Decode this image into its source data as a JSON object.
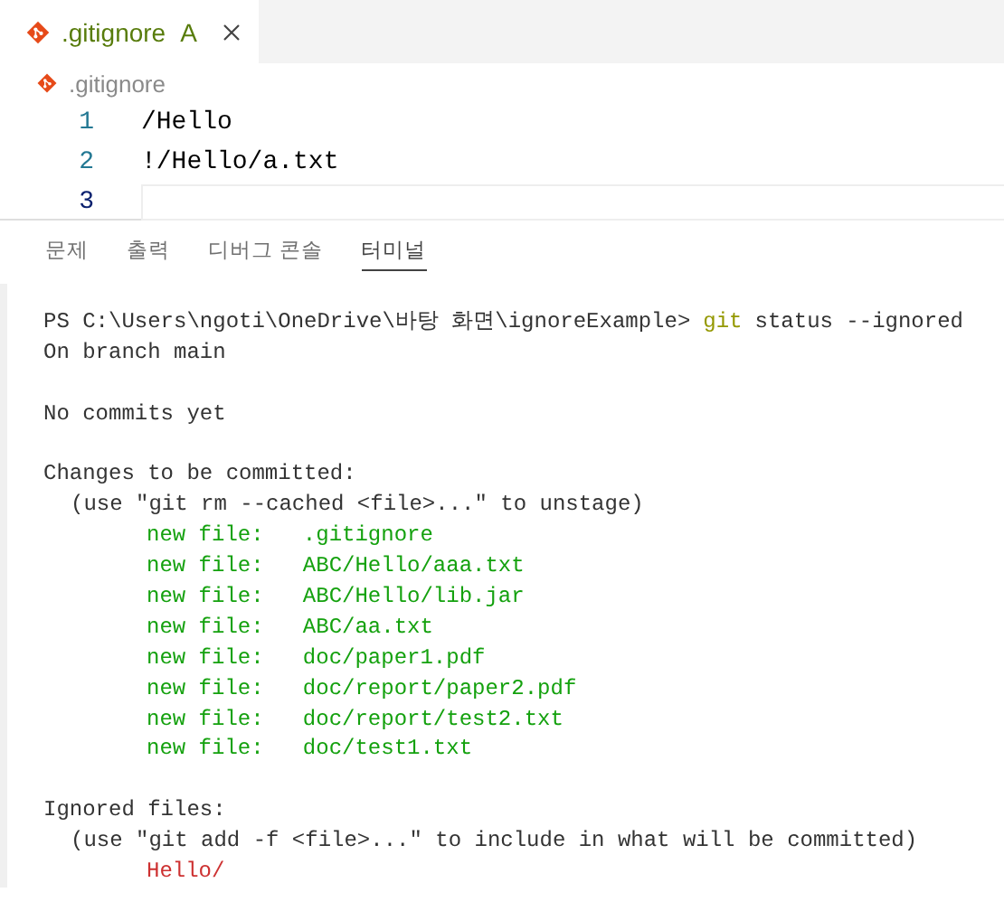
{
  "editor_tabs": [
    {
      "label": ".gitignore",
      "badge": "A",
      "selected": true
    }
  ],
  "breadcrumb": {
    "label": ".gitignore"
  },
  "code_lines": [
    {
      "number": "1",
      "text": "/Hello",
      "selected": false
    },
    {
      "number": "2",
      "text": "!/Hello/a.txt",
      "selected": false
    },
    {
      "number": "3",
      "selected": true
    }
  ],
  "panel_tabs": [
    {
      "label": "문제",
      "selected": false
    },
    {
      "label": "출력",
      "selected": false
    },
    {
      "label": "디버그 콘솔",
      "selected": false
    },
    {
      "label": "터미널",
      "selected": true
    }
  ],
  "terminal": {
    "blocks": [
      {
        "lines": [
          {
            "kind": "command",
            "prompt": "PS C:\\Users\\ngoti\\OneDrive\\바탕 화면\\ignoreExample>",
            "command": "git",
            "args": "status --ignored"
          },
          {
            "kind": "plain",
            "text": "On branch main"
          }
        ]
      },
      {
        "lines": [
          {
            "kind": "plain",
            "text": "No commits yet"
          }
        ]
      },
      {
        "lines": [
          {
            "kind": "plain",
            "text": "Changes to be committed:"
          },
          {
            "kind": "hint",
            "text": "(use \"git rm --cached <file>...\" to unstage)"
          },
          {
            "kind": "staged",
            "text": "new file:   .gitignore"
          },
          {
            "kind": "staged",
            "text": "new file:   ABC/Hello/aaa.txt"
          },
          {
            "kind": "staged",
            "text": "new file:   ABC/Hello/lib.jar"
          },
          {
            "kind": "staged",
            "text": "new file:   ABC/aa.txt"
          },
          {
            "kind": "staged",
            "text": "new file:   doc/paper1.pdf"
          },
          {
            "kind": "staged",
            "text": "new file:   doc/report/paper2.pdf"
          },
          {
            "kind": "staged",
            "text": "new file:   doc/report/test2.txt"
          },
          {
            "kind": "staged",
            "text": "new file:   doc/test1.txt"
          }
        ]
      },
      {
        "lines": [
          {
            "kind": "plain",
            "text": "Ignored files:"
          },
          {
            "kind": "hint",
            "text": "(use \"git add -f <file>...\" to include in what will be committed)"
          },
          {
            "kind": "ignored",
            "text": "Hello/"
          }
        ]
      }
    ]
  }
}
